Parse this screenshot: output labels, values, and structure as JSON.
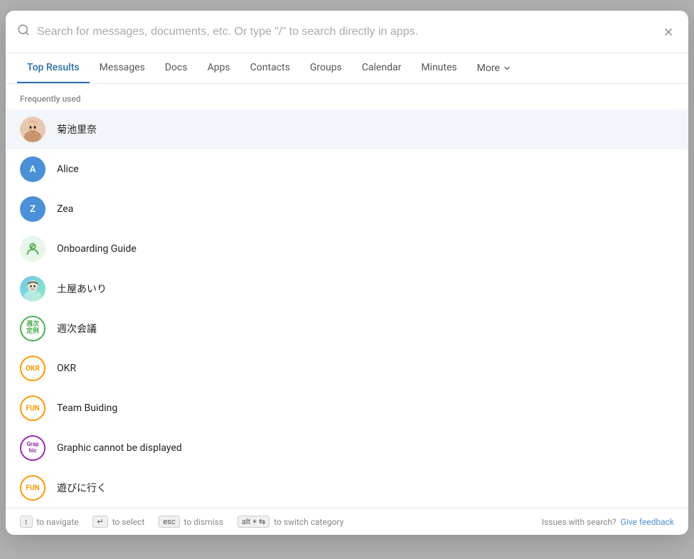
{
  "search": {
    "placeholder": "Search for messages, documents, etc. Or type \"/\" to search directly in apps.",
    "value": ""
  },
  "tabs": [
    {
      "id": "top-results",
      "label": "Top Results",
      "active": true
    },
    {
      "id": "messages",
      "label": "Messages",
      "active": false
    },
    {
      "id": "docs",
      "label": "Docs",
      "active": false
    },
    {
      "id": "apps",
      "label": "Apps",
      "active": false
    },
    {
      "id": "contacts",
      "label": "Contacts",
      "active": false
    },
    {
      "id": "groups",
      "label": "Groups",
      "active": false
    },
    {
      "id": "calendar",
      "label": "Calendar",
      "active": false
    },
    {
      "id": "minutes",
      "label": "Minutes",
      "active": false
    },
    {
      "id": "more",
      "label": "More",
      "active": false
    }
  ],
  "section_label": "Frequently used",
  "results": [
    {
      "id": 1,
      "name": "菊池里奈",
      "avatar_type": "photo",
      "highlighted": true
    },
    {
      "id": 2,
      "name": "Alice",
      "avatar_type": "letter",
      "letter": "A",
      "bg": "#4a90d9"
    },
    {
      "id": 3,
      "name": "Zea",
      "avatar_type": "letter",
      "letter": "Z",
      "bg": "#4a90d9"
    },
    {
      "id": 4,
      "name": "Onboarding Guide",
      "avatar_type": "onboarding"
    },
    {
      "id": 5,
      "name": "土屋あいり",
      "avatar_type": "gradient"
    },
    {
      "id": 6,
      "name": "週次会議",
      "avatar_type": "weekly",
      "text": "週次\n定例"
    },
    {
      "id": 7,
      "name": "OKR",
      "avatar_type": "okr",
      "text": "OKR"
    },
    {
      "id": 8,
      "name": "Team Buiding",
      "avatar_type": "fun",
      "text": "FUN"
    },
    {
      "id": 9,
      "name": "Graphic cannot be displayed",
      "avatar_type": "graphic",
      "text": "Grap\nhic"
    },
    {
      "id": 10,
      "name": "遊びに行く",
      "avatar_type": "fun2",
      "text": "FUN"
    }
  ],
  "footer": {
    "navigate_label": "to navigate",
    "select_label": "to select",
    "dismiss_label": "to dismiss",
    "switch_label": "to switch category",
    "issues_label": "Issues with search?",
    "feedback_label": "Give feedback"
  }
}
